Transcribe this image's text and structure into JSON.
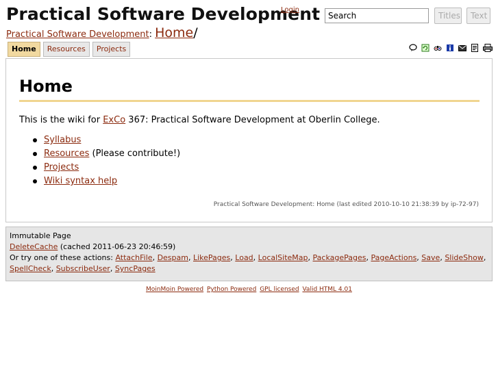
{
  "header": {
    "site_title": "Practical Software Development",
    "login_label": "Login",
    "search": {
      "value": "Search"
    },
    "titles_button": "Titles",
    "text_button": "Text"
  },
  "breadcrumb": {
    "site_link": "Practical Software Development",
    "separator": ":",
    "page_link": "Home",
    "trailing": "/"
  },
  "nav_tabs": [
    "Home",
    "Resources",
    "Projects"
  ],
  "action_icons": [
    "speech-bubble-icon",
    "refresh-icon",
    "diff-icon",
    "info-icon",
    "envelope-icon",
    "attachments-icon",
    "print-icon"
  ],
  "content": {
    "title": "Home",
    "intro_before": "This is the wiki for ",
    "intro_link": "ExCo",
    "intro_after": " 367: Practical Software Development at Oberlin College.",
    "items": [
      {
        "link": "Syllabus",
        "suffix": ""
      },
      {
        "link": "Resources",
        "suffix": " (Please contribute!)"
      },
      {
        "link": "Projects",
        "suffix": ""
      },
      {
        "link": "Wiki syntax help",
        "suffix": ""
      }
    ],
    "page_info": "Practical Software Development: Home (last edited 2010-10-10 21:38:39 by ip-72-97)"
  },
  "footer": {
    "immutable": "Immutable Page",
    "delete_cache_link": "DeleteCache",
    "cached_text": " (cached 2011-06-23 20:46:59)",
    "actions_prefix": "Or try one of these actions: ",
    "actions": [
      "AttachFile",
      "Despam",
      "LikePages",
      "Load",
      "LocalSiteMap",
      "PackagePages",
      "PageActions",
      "Save",
      "SlideShow",
      "SpellCheck",
      "SubscribeUser",
      "SyncPages"
    ]
  },
  "credits": [
    "MoinMoin Powered",
    "Python Powered",
    "GPL licensed",
    "Valid HTML 4.01"
  ]
}
